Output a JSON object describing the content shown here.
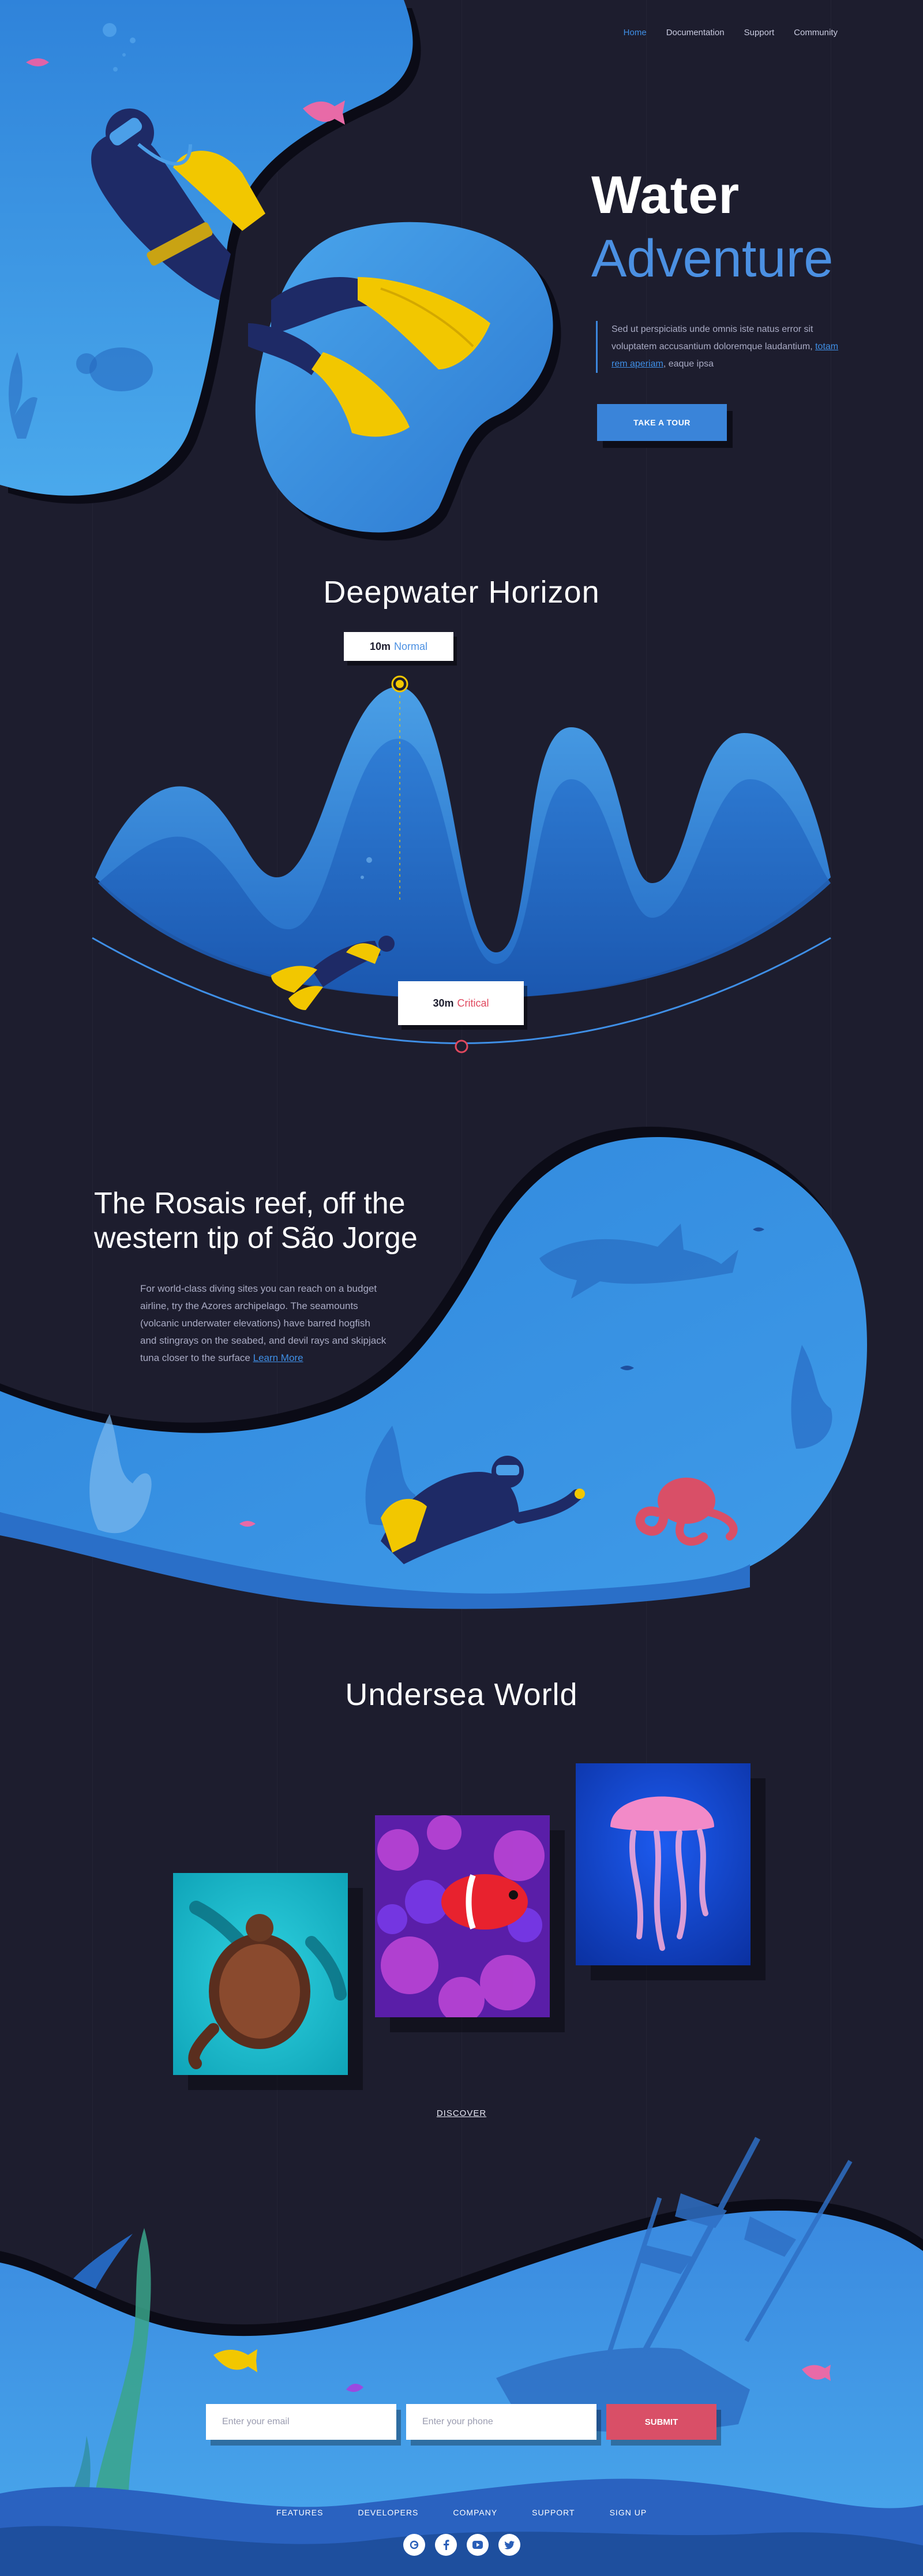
{
  "nav": {
    "items": [
      {
        "label": "Home",
        "active": true
      },
      {
        "label": "Documentation",
        "active": false
      },
      {
        "label": "Support",
        "active": false
      },
      {
        "label": "Community",
        "active": false
      }
    ]
  },
  "hero": {
    "title_line1": "Water",
    "title_line2": "Adventure",
    "text_before": "Sed ut perspiciatis unde omnis iste natus error sit voluptatem accusantium doloremque laudantium, ",
    "link": "totam rem aperiam",
    "text_after": ", eaque ipsa",
    "button": "TAKE A TOUR"
  },
  "deepwater": {
    "title": "Deepwater Horizon",
    "marker_top": {
      "depth": "10m",
      "status": "Normal"
    },
    "marker_bottom": {
      "depth": "30m",
      "status": "Critical"
    }
  },
  "reef": {
    "title": "The Rosais reef, off the western tip of São Jorge",
    "text": "For world-class diving sites you can reach on a budget airline, try the Azores archipelago. The seamounts (volcanic underwater elevations) have barred hogfish and stingrays on the seabed, and devil rays and skipjack tuna closer to the surface ",
    "link": "Learn More"
  },
  "gallery": {
    "title": "Undersea World",
    "discover": "DISCOVER"
  },
  "form": {
    "email_placeholder": "Enter your email",
    "phone_placeholder": "Enter your phone",
    "submit": "SUBMIT"
  },
  "footer": {
    "links": [
      "FEATURES",
      "DEVELOPERS",
      "COMPANY",
      "SUPPORT",
      "SIGN UP"
    ],
    "socials": [
      "google-plus-icon",
      "facebook-icon",
      "youtube-icon",
      "twitter-icon"
    ]
  },
  "colors": {
    "background": "#1d1d2e",
    "accent": "#4b90e2",
    "critical": "#e0485e",
    "sea_light": "#4aa9ec",
    "sea_dark": "#1e5fb8"
  }
}
